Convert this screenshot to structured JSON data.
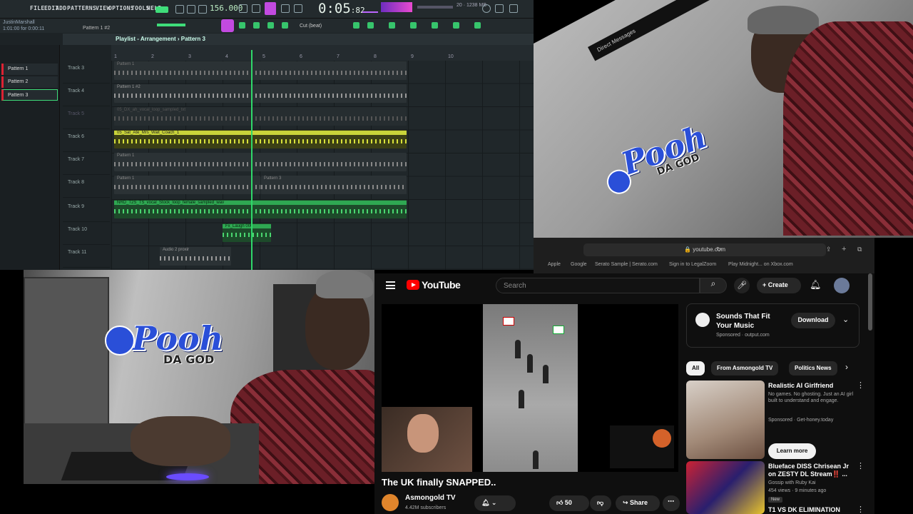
{
  "fl": {
    "menu": [
      "FILE",
      "EDIT",
      "ADD",
      "PATTERNS",
      "VIEW",
      "OPTIONS",
      "TOOLS",
      "HELP"
    ],
    "tempo": "156.000",
    "time": "0:05",
    "time_sub": ":82",
    "user_line1": "JustinMarshall",
    "user_line2": "1:01:00 for 0:00:11",
    "pattern_label": "Pattern 1 #2",
    "snap_label": "Cut (beat)",
    "playlist_title": "Playlist - Arrangement › Pattern 3",
    "patterns": [
      "Pattern 1",
      "Pattern 2",
      "Pattern 3"
    ],
    "ruler": [
      "1",
      "2",
      "3",
      "4",
      "5",
      "6",
      "7",
      "8",
      "9",
      "10"
    ],
    "tracks": [
      "Track 3",
      "Track 4",
      "Track 5",
      "Track 6",
      "Track 7",
      "Track 8",
      "Track 9",
      "Track 10",
      "Track 11"
    ],
    "clips": [
      {
        "label": "Pattern 1"
      },
      {
        "label": "Pattern 1 #2"
      },
      {
        "label": "05_DX_ah_vocal_loop_sampled_txt"
      },
      {
        "label": "05_Sat_Ate_Mrs_Wait_Coach_1"
      },
      {
        "label": "Pattern 1"
      },
      {
        "label": "Pattern 1"
      },
      {
        "label": "Pattern 3"
      },
      {
        "label": "NRD_T2S_TS_vocal_Stock_loop_female_sampled_wav"
      },
      {
        "label": "Fx_Laugh 006"
      },
      {
        "label": "Audio 2 proxir"
      }
    ]
  },
  "cam1": {
    "dm_label": "Direct Messages"
  },
  "logo": {
    "word": "Pooh",
    "sub": "DA GOD"
  },
  "safari": {
    "url": "youtube.com",
    "favorites": [
      "Apple",
      "Google",
      "Serato Sample | Serato.com",
      "Sign in to LegalZoom",
      "Play Midnight... on Xbox.com"
    ]
  },
  "yt": {
    "logo": "YouTube",
    "search_placeholder": "Search",
    "create": "Create",
    "video_title": "The UK finally SNAPPED..",
    "channel": "Asmongold TV",
    "subs": "4.42M subscribers",
    "likes": "50",
    "share": "Share",
    "ad_title": "Sounds That Fit Your Music",
    "ad_sponsored": "Sponsored · output.com",
    "download": "Download",
    "chips": [
      "All",
      "From Asmongold TV",
      "Politics News"
    ],
    "recs": [
      {
        "title": "Realistic AI Girlfriend",
        "meta": "No games. No ghosting. Just an AI girl built to understand and engage.",
        "meta2": "Sponsored · Get-honey.today"
      },
      {
        "title": "Blueface DISS Chrisean Jr on ZESTY DL Stream‼️ ...",
        "meta": "Gossip with Ruby Kai",
        "meta2": "454 views · 9 minutes ago"
      },
      {
        "title": "T1 VS DK ELIMINATION",
        "meta": "",
        "meta2": ""
      }
    ],
    "learn_more": "Learn more",
    "new_badge": "New"
  }
}
